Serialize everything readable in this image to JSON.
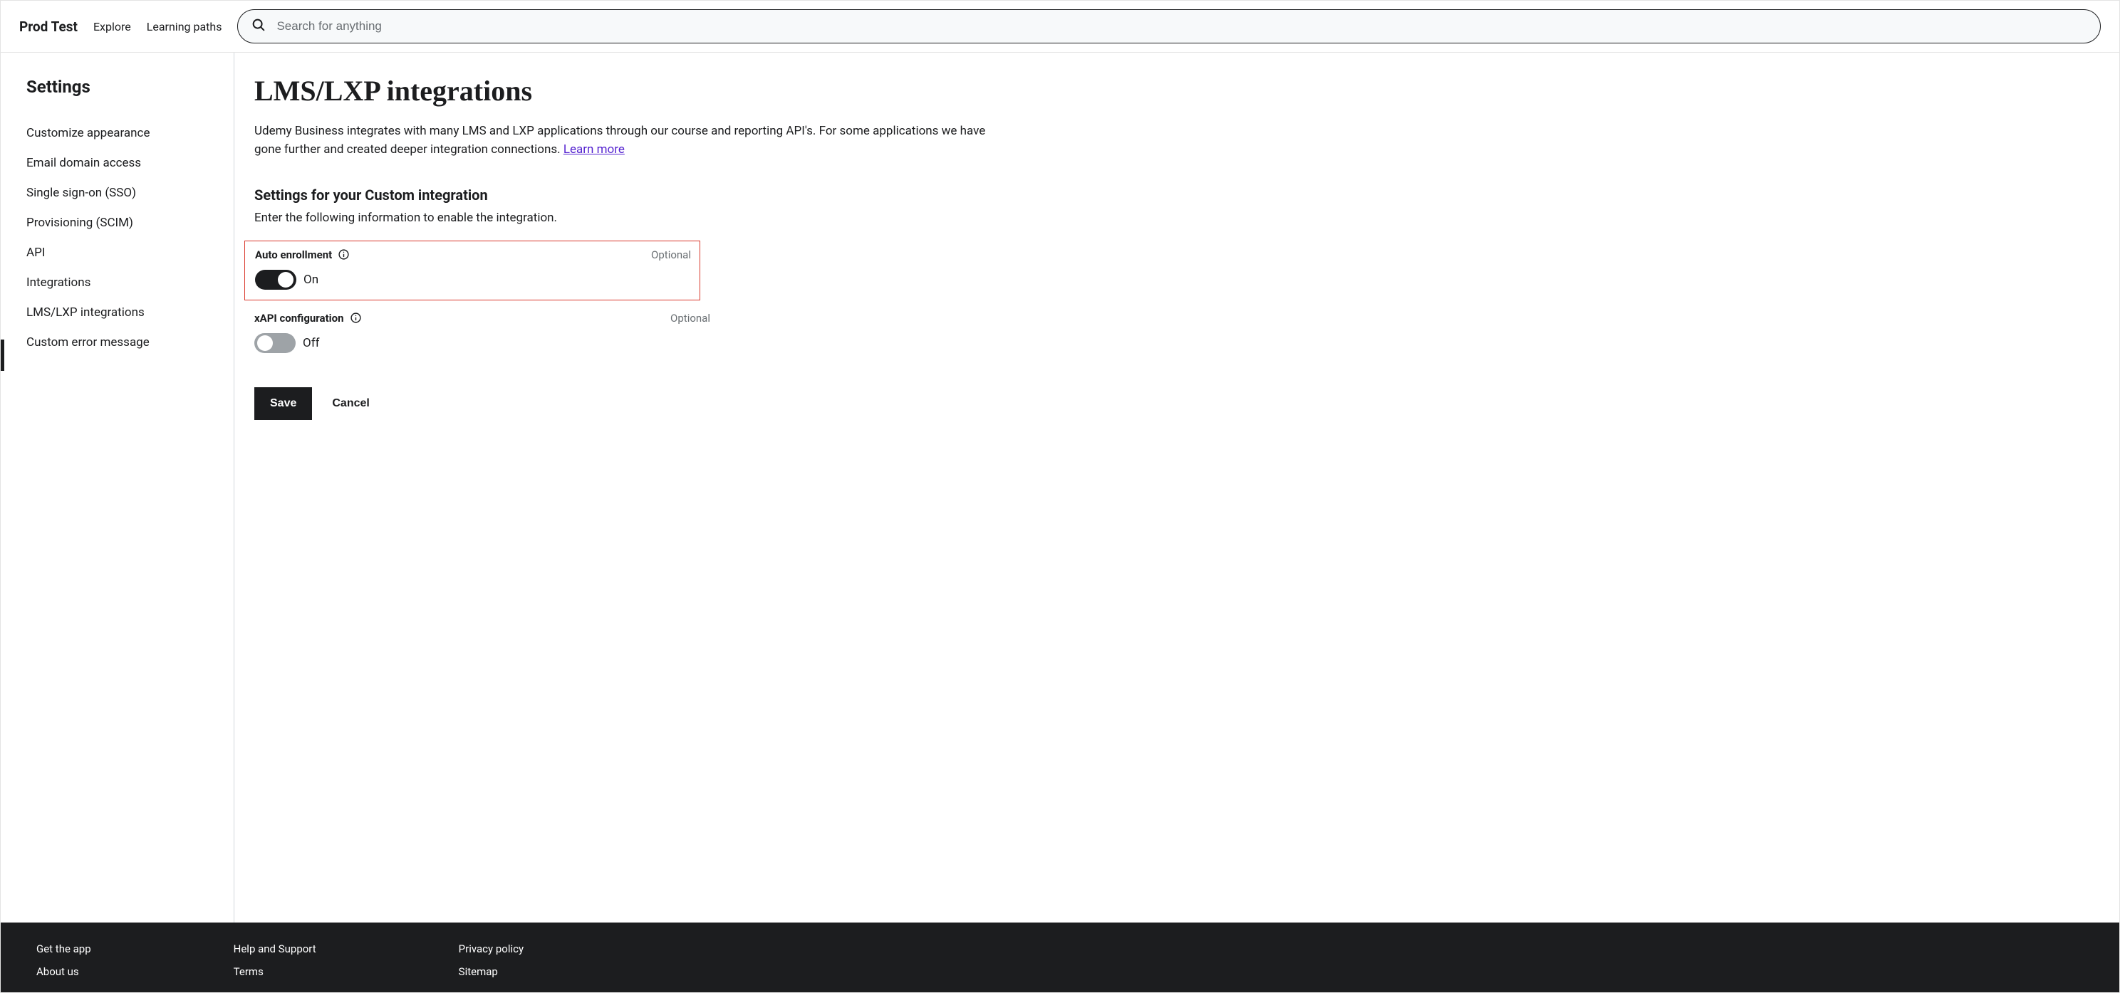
{
  "header": {
    "brand": "Prod Test",
    "explore": "Explore",
    "learning_paths": "Learning paths",
    "search_placeholder": "Search for anything"
  },
  "sidebar": {
    "title": "Settings",
    "items": [
      {
        "label": "Customize appearance"
      },
      {
        "label": "Email domain access"
      },
      {
        "label": "Single sign-on (SSO)"
      },
      {
        "label": "Provisioning (SCIM)"
      },
      {
        "label": "API"
      },
      {
        "label": "Integrations"
      },
      {
        "label": "LMS/LXP integrations"
      },
      {
        "label": "Custom error message"
      }
    ],
    "active_index": 6
  },
  "main": {
    "title": "LMS/LXP integrations",
    "description_part1": "Udemy Business integrates with many LMS and LXP applications through our course and reporting API's. For some applications we have gone further and created deeper integration connections. ",
    "learn_more": "Learn more",
    "section_heading": "Settings for your Custom integration",
    "section_sub": "Enter the following information to enable the integration.",
    "optional_label": "Optional",
    "settings": {
      "auto_enrollment": {
        "label": "Auto enrollment",
        "state": "On",
        "on": true
      },
      "xapi": {
        "label": "xAPI configuration",
        "state": "Off",
        "on": false
      }
    },
    "save": "Save",
    "cancel": "Cancel"
  },
  "footer": {
    "col1": [
      {
        "label": "Get the app"
      },
      {
        "label": "About us"
      }
    ],
    "col2": [
      {
        "label": "Help and Support"
      },
      {
        "label": "Terms"
      }
    ],
    "col3": [
      {
        "label": "Privacy policy"
      },
      {
        "label": "Sitemap"
      }
    ]
  }
}
